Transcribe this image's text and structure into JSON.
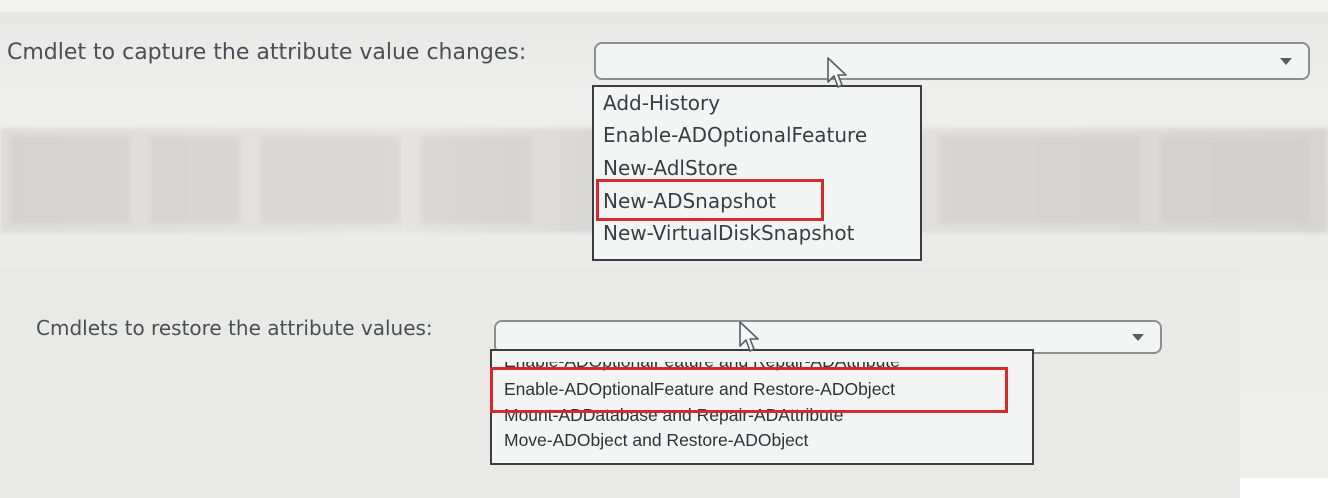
{
  "question1": {
    "label": "Cmdlet to capture the attribute value changes:",
    "selected": "",
    "options": [
      "Add-History",
      "Enable-ADOptionalFeature",
      "New-AdlStore",
      "New-ADSnapshot",
      "New-VirtualDiskSnapshot"
    ],
    "highlighted_option": "New-ADSnapshot"
  },
  "question2": {
    "label": "Cmdlets to restore the attribute values:",
    "selected": "",
    "options": [
      "Enable-ADOptionalFeature and Repair-ADAttribute",
      "Enable-ADOptionalFeature and Restore-ADObject",
      "Mount-ADDatabase and Repair-ADAttribute",
      "Move-ADObject and Restore-ADObject"
    ],
    "highlighted_option": "Enable-ADOptionalFeature and Restore-ADObject"
  },
  "icons": {
    "dropdown_arrow": "chevron-down-icon",
    "cursor": "mouse-pointer-icon"
  },
  "colors": {
    "highlight_border": "#d7282e",
    "text": "#4a4e55"
  }
}
